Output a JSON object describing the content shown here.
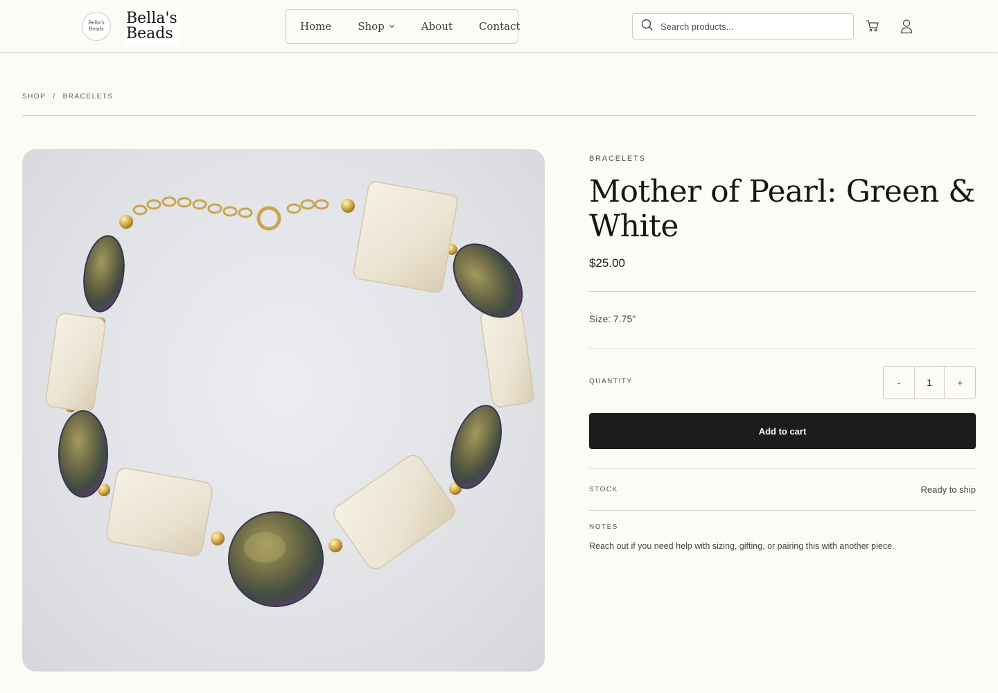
{
  "header": {
    "logo_badge_line1": "Bella's",
    "logo_badge_line2": "Beads",
    "logo_line1": "Bella's",
    "logo_line2": "Beads",
    "nav": [
      {
        "label": "Home"
      },
      {
        "label": "Shop"
      },
      {
        "label": "About"
      },
      {
        "label": "Contact"
      }
    ],
    "search_placeholder": "Search products..."
  },
  "breadcrumb": {
    "items": [
      "SHOP",
      "BRACELETS"
    ],
    "separator": "/"
  },
  "product": {
    "category": "BRACELETS",
    "title": "Mother of Pearl: Green & White",
    "price": "$25.00",
    "size": "Size: 7.75\"",
    "quantity_label": "QUANTITY",
    "quantity": "1",
    "decrement_label": "-",
    "increment_label": "+",
    "add_to_cart_label": "Add to cart",
    "stock_label": "STOCK",
    "stock_value": "Ready to ship",
    "notes_label": "NOTES",
    "notes_text": "Reach out if you need help with sizing, gifting, or pairing this with another piece."
  },
  "colors": {
    "background": "#fdfbf6",
    "button": "#1d1c1a",
    "border": "#cfcac0"
  }
}
